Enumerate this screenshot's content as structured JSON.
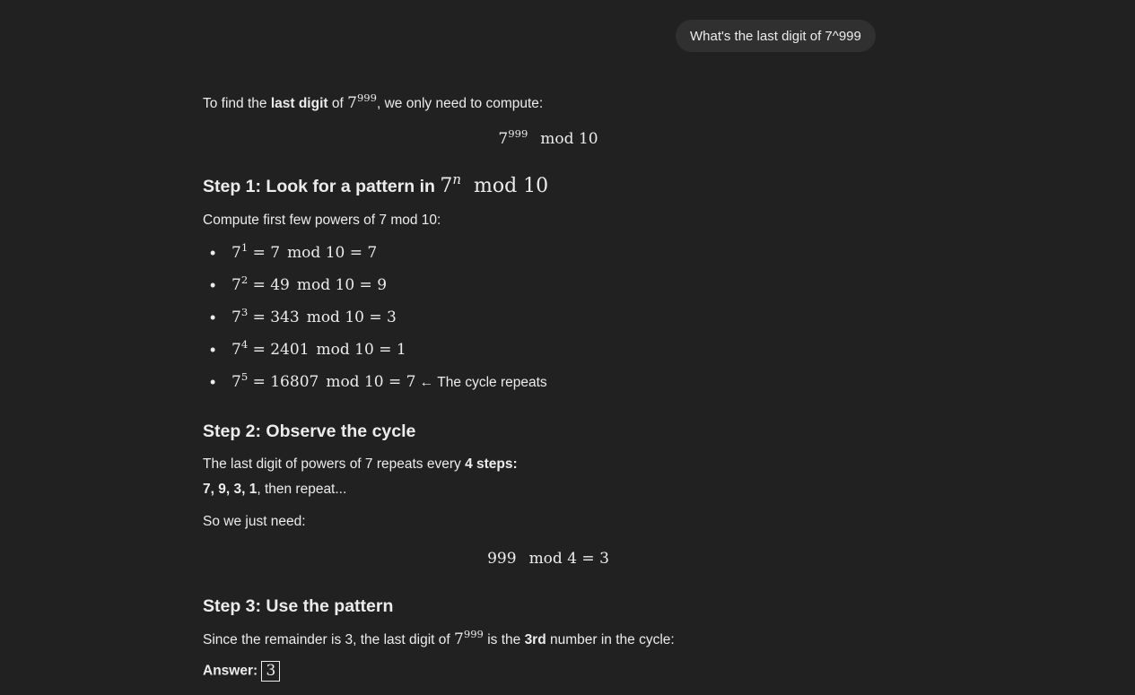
{
  "user_message": "What's the last digit of 7^999",
  "intro": {
    "t1": "To find the ",
    "bold": "last digit",
    "t2": " of ",
    "base": "7",
    "exp": "999",
    "t3": ", we only need to compute:"
  },
  "display1": {
    "base": "7",
    "exp": "999",
    "rest": "mod 10"
  },
  "step1": {
    "heading_text": "Step 1: Look for a pattern in ",
    "base": "7",
    "exp": "n",
    "rest": "mod 10",
    "intro": "Compute first few powers of 7 mod 10:",
    "items": [
      {
        "base": "7",
        "exp": "1",
        "value": "= 7",
        "mod": "mod 10 = 7",
        "note": ""
      },
      {
        "base": "7",
        "exp": "2",
        "value": "= 49",
        "mod": "mod 10 = 9",
        "note": ""
      },
      {
        "base": "7",
        "exp": "3",
        "value": "= 343",
        "mod": "mod 10 = 3",
        "note": ""
      },
      {
        "base": "7",
        "exp": "4",
        "value": "= 2401",
        "mod": "mod 10 = 1",
        "note": ""
      },
      {
        "base": "7",
        "exp": "5",
        "value": "= 16807",
        "mod": "mod 10 = 7",
        "note": "← The cycle repeats"
      }
    ]
  },
  "step2": {
    "heading": "Step 2: Observe the cycle",
    "line1_text": "The last digit of powers of 7 repeats every ",
    "line1_bold": "4 steps",
    "line1_end": ":",
    "line2_bold": "7, 9, 3, 1",
    "line2_text": ", then repeat...",
    "line3": "So we just need:",
    "display_left": "999",
    "display_right": "mod 4 = 3"
  },
  "step3": {
    "heading": "Step 3: Use the pattern",
    "t1": "Since the remainder is 3, the last digit of ",
    "base": "7",
    "exp": "999",
    "t2": " is the ",
    "bold": "3rd",
    "t3": " number in the cycle:",
    "answer_label": "Answer:",
    "answer_value": "3"
  }
}
